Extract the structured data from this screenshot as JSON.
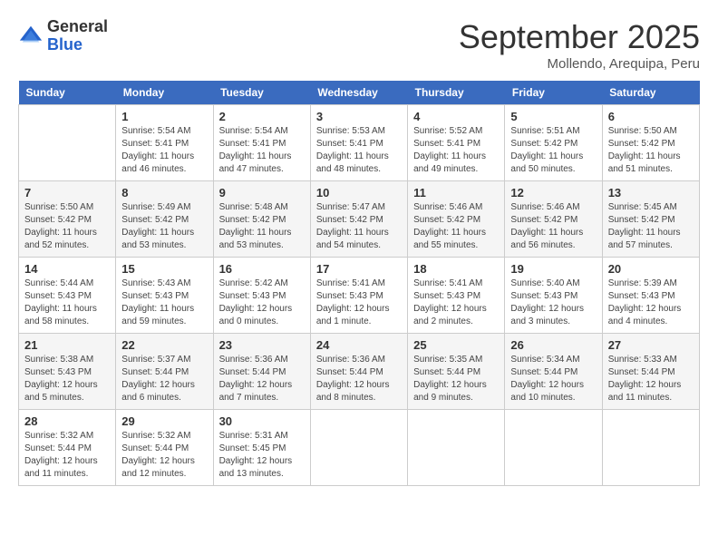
{
  "header": {
    "logo_general": "General",
    "logo_blue": "Blue",
    "month": "September 2025",
    "location": "Mollendo, Arequipa, Peru"
  },
  "days_of_week": [
    "Sunday",
    "Monday",
    "Tuesday",
    "Wednesday",
    "Thursday",
    "Friday",
    "Saturday"
  ],
  "weeks": [
    [
      {
        "day": "",
        "sunrise": "",
        "sunset": "",
        "daylight": ""
      },
      {
        "day": "1",
        "sunrise": "Sunrise: 5:54 AM",
        "sunset": "Sunset: 5:41 PM",
        "daylight": "Daylight: 11 hours and 46 minutes."
      },
      {
        "day": "2",
        "sunrise": "Sunrise: 5:54 AM",
        "sunset": "Sunset: 5:41 PM",
        "daylight": "Daylight: 11 hours and 47 minutes."
      },
      {
        "day": "3",
        "sunrise": "Sunrise: 5:53 AM",
        "sunset": "Sunset: 5:41 PM",
        "daylight": "Daylight: 11 hours and 48 minutes."
      },
      {
        "day": "4",
        "sunrise": "Sunrise: 5:52 AM",
        "sunset": "Sunset: 5:41 PM",
        "daylight": "Daylight: 11 hours and 49 minutes."
      },
      {
        "day": "5",
        "sunrise": "Sunrise: 5:51 AM",
        "sunset": "Sunset: 5:42 PM",
        "daylight": "Daylight: 11 hours and 50 minutes."
      },
      {
        "day": "6",
        "sunrise": "Sunrise: 5:50 AM",
        "sunset": "Sunset: 5:42 PM",
        "daylight": "Daylight: 11 hours and 51 minutes."
      }
    ],
    [
      {
        "day": "7",
        "sunrise": "Sunrise: 5:50 AM",
        "sunset": "Sunset: 5:42 PM",
        "daylight": "Daylight: 11 hours and 52 minutes."
      },
      {
        "day": "8",
        "sunrise": "Sunrise: 5:49 AM",
        "sunset": "Sunset: 5:42 PM",
        "daylight": "Daylight: 11 hours and 53 minutes."
      },
      {
        "day": "9",
        "sunrise": "Sunrise: 5:48 AM",
        "sunset": "Sunset: 5:42 PM",
        "daylight": "Daylight: 11 hours and 53 minutes."
      },
      {
        "day": "10",
        "sunrise": "Sunrise: 5:47 AM",
        "sunset": "Sunset: 5:42 PM",
        "daylight": "Daylight: 11 hours and 54 minutes."
      },
      {
        "day": "11",
        "sunrise": "Sunrise: 5:46 AM",
        "sunset": "Sunset: 5:42 PM",
        "daylight": "Daylight: 11 hours and 55 minutes."
      },
      {
        "day": "12",
        "sunrise": "Sunrise: 5:46 AM",
        "sunset": "Sunset: 5:42 PM",
        "daylight": "Daylight: 11 hours and 56 minutes."
      },
      {
        "day": "13",
        "sunrise": "Sunrise: 5:45 AM",
        "sunset": "Sunset: 5:42 PM",
        "daylight": "Daylight: 11 hours and 57 minutes."
      }
    ],
    [
      {
        "day": "14",
        "sunrise": "Sunrise: 5:44 AM",
        "sunset": "Sunset: 5:43 PM",
        "daylight": "Daylight: 11 hours and 58 minutes."
      },
      {
        "day": "15",
        "sunrise": "Sunrise: 5:43 AM",
        "sunset": "Sunset: 5:43 PM",
        "daylight": "Daylight: 11 hours and 59 minutes."
      },
      {
        "day": "16",
        "sunrise": "Sunrise: 5:42 AM",
        "sunset": "Sunset: 5:43 PM",
        "daylight": "Daylight: 12 hours and 0 minutes."
      },
      {
        "day": "17",
        "sunrise": "Sunrise: 5:41 AM",
        "sunset": "Sunset: 5:43 PM",
        "daylight": "Daylight: 12 hours and 1 minute."
      },
      {
        "day": "18",
        "sunrise": "Sunrise: 5:41 AM",
        "sunset": "Sunset: 5:43 PM",
        "daylight": "Daylight: 12 hours and 2 minutes."
      },
      {
        "day": "19",
        "sunrise": "Sunrise: 5:40 AM",
        "sunset": "Sunset: 5:43 PM",
        "daylight": "Daylight: 12 hours and 3 minutes."
      },
      {
        "day": "20",
        "sunrise": "Sunrise: 5:39 AM",
        "sunset": "Sunset: 5:43 PM",
        "daylight": "Daylight: 12 hours and 4 minutes."
      }
    ],
    [
      {
        "day": "21",
        "sunrise": "Sunrise: 5:38 AM",
        "sunset": "Sunset: 5:43 PM",
        "daylight": "Daylight: 12 hours and 5 minutes."
      },
      {
        "day": "22",
        "sunrise": "Sunrise: 5:37 AM",
        "sunset": "Sunset: 5:44 PM",
        "daylight": "Daylight: 12 hours and 6 minutes."
      },
      {
        "day": "23",
        "sunrise": "Sunrise: 5:36 AM",
        "sunset": "Sunset: 5:44 PM",
        "daylight": "Daylight: 12 hours and 7 minutes."
      },
      {
        "day": "24",
        "sunrise": "Sunrise: 5:36 AM",
        "sunset": "Sunset: 5:44 PM",
        "daylight": "Daylight: 12 hours and 8 minutes."
      },
      {
        "day": "25",
        "sunrise": "Sunrise: 5:35 AM",
        "sunset": "Sunset: 5:44 PM",
        "daylight": "Daylight: 12 hours and 9 minutes."
      },
      {
        "day": "26",
        "sunrise": "Sunrise: 5:34 AM",
        "sunset": "Sunset: 5:44 PM",
        "daylight": "Daylight: 12 hours and 10 minutes."
      },
      {
        "day": "27",
        "sunrise": "Sunrise: 5:33 AM",
        "sunset": "Sunset: 5:44 PM",
        "daylight": "Daylight: 12 hours and 11 minutes."
      }
    ],
    [
      {
        "day": "28",
        "sunrise": "Sunrise: 5:32 AM",
        "sunset": "Sunset: 5:44 PM",
        "daylight": "Daylight: 12 hours and 11 minutes."
      },
      {
        "day": "29",
        "sunrise": "Sunrise: 5:32 AM",
        "sunset": "Sunset: 5:44 PM",
        "daylight": "Daylight: 12 hours and 12 minutes."
      },
      {
        "day": "30",
        "sunrise": "Sunrise: 5:31 AM",
        "sunset": "Sunset: 5:45 PM",
        "daylight": "Daylight: 12 hours and 13 minutes."
      },
      {
        "day": "",
        "sunrise": "",
        "sunset": "",
        "daylight": ""
      },
      {
        "day": "",
        "sunrise": "",
        "sunset": "",
        "daylight": ""
      },
      {
        "day": "",
        "sunrise": "",
        "sunset": "",
        "daylight": ""
      },
      {
        "day": "",
        "sunrise": "",
        "sunset": "",
        "daylight": ""
      }
    ]
  ]
}
